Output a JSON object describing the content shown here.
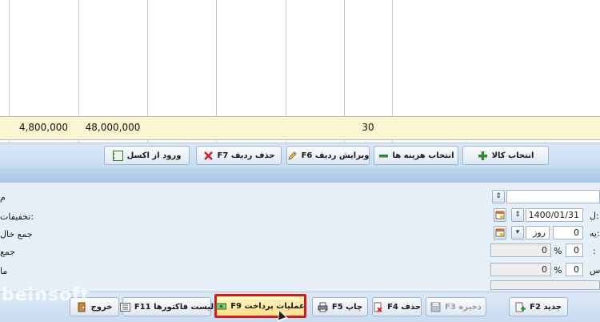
{
  "grid": {
    "totals": {
      "c1": "4,800,000",
      "c2": "48,000,000",
      "qty": "30"
    }
  },
  "toolbar": {
    "import_excel": "ورود از اکسل",
    "delete_row": "حذف ردیف F7",
    "edit_row": "ویرایش ردیف F6",
    "select_cost": "انتخاب هزینه ها",
    "select_item": "انتخاب کالا"
  },
  "form": {
    "left_labels": [
      "م",
      "تخفیفات:",
      "جمع خال",
      "جمع",
      "ما"
    ],
    "right_labels": [
      "ل:",
      "یه:",
      ":",
      "س:"
    ],
    "date_value": "1400/01/31",
    "unit_value": "روز",
    "days_value": "0",
    "percent_value_1": "0",
    "percent_value_2": "0",
    "percent_amount_1": "0",
    "percent_amount_2": "0",
    "percent_sign": "%"
  },
  "bottom": {
    "new": "جدید F2",
    "save": "ذخیره F3",
    "delete": "حذف F4",
    "print": "چاپ F5",
    "payment": "عملیات پرداخت F9",
    "invoice_list": "لیست فاکتورها F11",
    "exit": "خروج"
  },
  "watermark": "beinsoft",
  "colors": {
    "accent_red": "#d21c1c",
    "total_row": "#fdf5d2",
    "toolbar": "#c7dbf1"
  }
}
